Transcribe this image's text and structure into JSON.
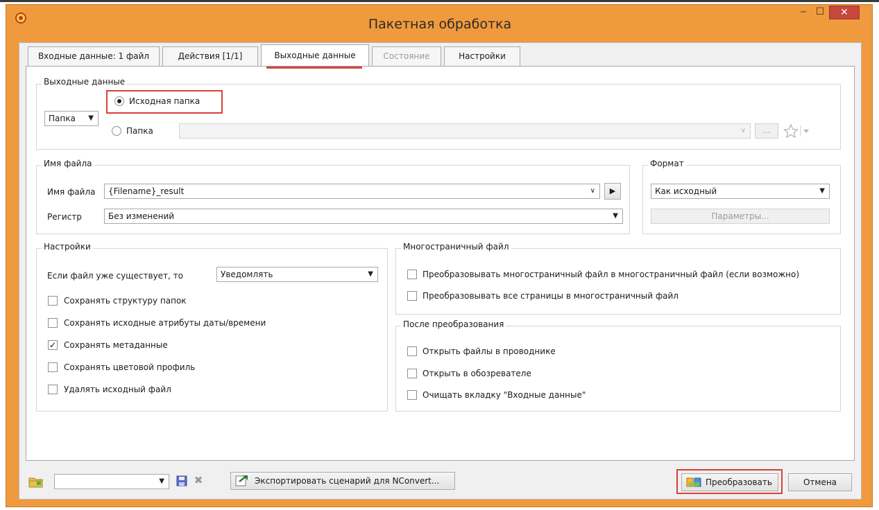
{
  "window": {
    "title": "Пакетная обработка",
    "minimize_glyph": "‒",
    "maximize_glyph": "☐",
    "close_glyph": "✕"
  },
  "tabs": [
    {
      "label": "Входные данные: 1 файл",
      "state": "normal"
    },
    {
      "label": "Действия [1/1]",
      "state": "normal"
    },
    {
      "label": "Выходные данные",
      "state": "active"
    },
    {
      "label": "Состояние",
      "state": "disabled"
    },
    {
      "label": "Настройки",
      "state": "normal"
    }
  ],
  "output": {
    "group_label": "Выходные данные",
    "mode_combo": "Папка",
    "radio_source_label": "Исходная папка",
    "radio_source_checked": true,
    "radio_folder_label": "Папка",
    "radio_folder_checked": false,
    "folder_path": "",
    "browse_label": "...",
    "favorites_icon": "star-icon"
  },
  "filename": {
    "group_label": "Имя файла",
    "name_label": "Имя файла",
    "name_value": "{Filename}_result",
    "case_label": "Регистр",
    "case_value": "Без изменений"
  },
  "format": {
    "group_label": "Формат",
    "value": "Как исходный",
    "params_label": "Параметры..."
  },
  "settings": {
    "group_label": "Настройки",
    "exists_label": "Если файл уже существует, то",
    "exists_value": "Уведомлять",
    "options": [
      {
        "label": "Сохранять структуру папок",
        "checked": false
      },
      {
        "label": "Сохранять исходные атрибуты даты/времени",
        "checked": false
      },
      {
        "label": "Сохранять метаданные",
        "checked": true
      },
      {
        "label": "Сохранять цветовой профиль",
        "checked": false
      },
      {
        "label": "Удалять исходный файл",
        "checked": false
      }
    ]
  },
  "multipage": {
    "group_label": "Многостраничный файл",
    "options": [
      {
        "label": "Преобразовывать многостраничный файл в многостраничный файл (если возможно)",
        "checked": false
      },
      {
        "label": "Преобразовывать все страницы в многостраничный файл",
        "checked": false
      }
    ]
  },
  "after": {
    "group_label": "После преобразования",
    "options": [
      {
        "label": "Открыть файлы в проводнике",
        "checked": false
      },
      {
        "label": "Открыть в обозревателе",
        "checked": false
      },
      {
        "label": "Очищать вкладку \"Входные данные\"",
        "checked": false
      }
    ]
  },
  "bottom": {
    "script_combo": "",
    "export_label": "Экспортировать сценарий для NConvert...",
    "convert_label": "Преобразовать",
    "cancel_label": "Отмена"
  },
  "colors": {
    "window_frame": "#f09a3e",
    "close_button": "#c7463e",
    "highlight": "#d7403a"
  }
}
